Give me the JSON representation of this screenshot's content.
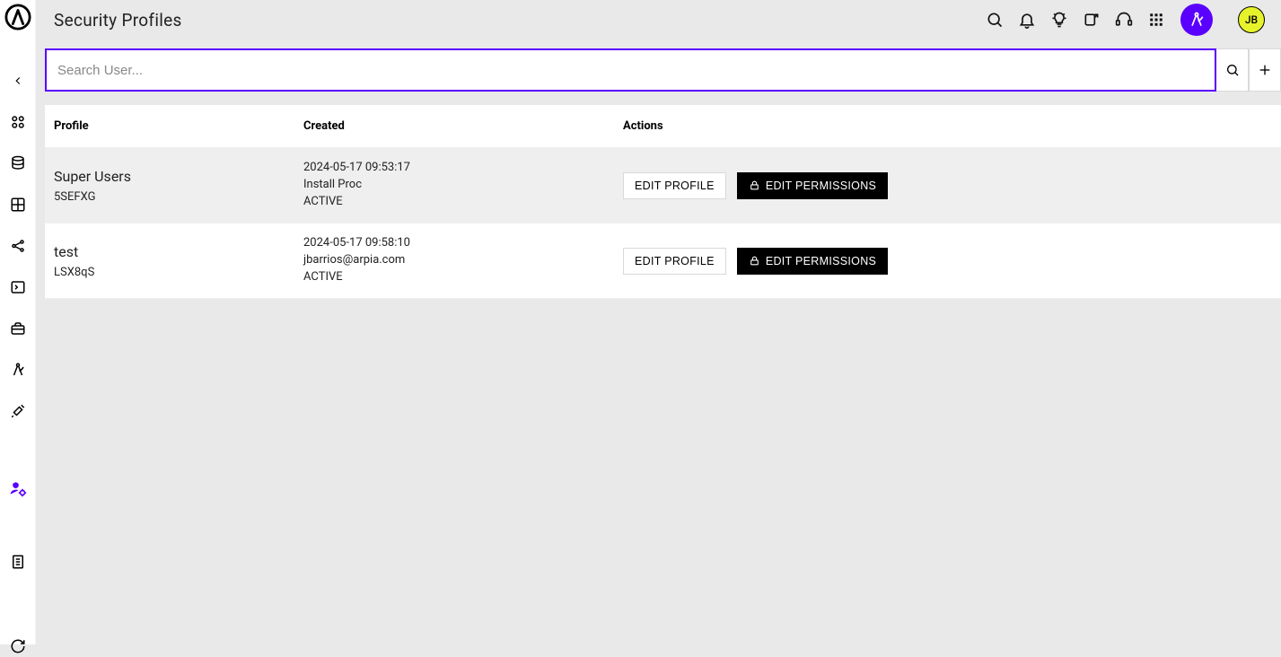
{
  "header": {
    "title": "Security Profiles",
    "avatar_initials": "JB"
  },
  "search": {
    "placeholder": "Search User..."
  },
  "table": {
    "columns": {
      "profile": "Profile",
      "created": "Created",
      "actions": "Actions"
    },
    "rows": [
      {
        "name": "Super Users",
        "id": "5SEFXG",
        "created_at": "2024-05-17 09:53:17",
        "created_by": "Install Proc",
        "status": "ACTIVE",
        "edit_profile_label": "EDIT PROFILE",
        "edit_permissions_label": "EDIT PERMISSIONS",
        "highlighted": true
      },
      {
        "name": "test",
        "id": "LSX8qS",
        "created_at": "2024-05-17 09:58:10",
        "created_by": "jbarrios@arpia.com",
        "status": "ACTIVE",
        "edit_profile_label": "EDIT PROFILE",
        "edit_permissions_label": "EDIT PERMISSIONS",
        "highlighted": false
      }
    ]
  },
  "colors": {
    "accent": "#5a00ff",
    "avatar_bg": "#e7f32a"
  }
}
